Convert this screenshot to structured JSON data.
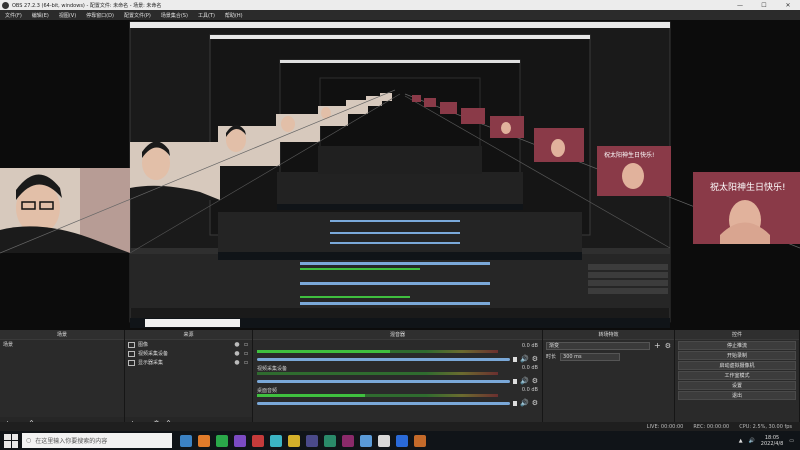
{
  "window": {
    "title": "OBS 27.2.3 (64-bit, windows) - 配置文件: 未命名 - 场景: 未命名",
    "min": "—",
    "max": "☐",
    "close": "✕"
  },
  "menu": [
    "文件(F)",
    "编辑(E)",
    "视图(V)",
    "停靠窗口(D)",
    "配置文件(P)",
    "场景集合(S)",
    "工具(T)",
    "帮助(H)"
  ],
  "preview": {
    "banner_text": "祝太阳神生日快乐!"
  },
  "docks": {
    "scenes": "场景",
    "sources": "来源",
    "mixer": "混音器",
    "transitions": "转场特效",
    "controls": "控件"
  },
  "scenes": {
    "items": [
      "场景"
    ]
  },
  "sources": {
    "items": [
      {
        "name": "图像",
        "icon": "image-icon"
      },
      {
        "name": "视频采集设备",
        "icon": "camera-icon"
      },
      {
        "name": "显示器采集",
        "icon": "monitor-icon"
      }
    ]
  },
  "mixer": {
    "channels": [
      {
        "name": "",
        "volume": "0.0 dB",
        "level": 0.55
      },
      {
        "name": "视频采集设备",
        "volume": "0.0 dB",
        "level": 0.0
      },
      {
        "name": "桌面音频",
        "volume": "0.0 dB",
        "level": 0.45
      }
    ]
  },
  "transitions": {
    "type": "渐变",
    "duration_label": "时长",
    "duration_value": "300 ms"
  },
  "controls": [
    "停止推流",
    "开始录制",
    "启动虚拟摄像机",
    "工作室模式",
    "设置",
    "退出"
  ],
  "status": {
    "live": "LIVE: 00:00:00",
    "rec": "REC: 00:00:00",
    "cpu": "CPU: 2.5%, 30.00 fps"
  },
  "taskbar": {
    "search_placeholder": "在这里输入你要搜索的内容",
    "time": "18:05",
    "date": "2022/4/8",
    "icons": [
      "#3b82c4",
      "#e07b2a",
      "#2aa84a",
      "#7b4bc4",
      "#c43b3b",
      "#3bb4c4",
      "#d4b02a",
      "#4a4a8a",
      "#2a8a6a",
      "#8a2a6a",
      "#5a9ad8",
      "#d8d8d8",
      "#2a6ad8",
      "#c46a2a"
    ]
  },
  "colors": {
    "accent": "#7aa8d8",
    "meter_green": "#3fbf3f"
  }
}
